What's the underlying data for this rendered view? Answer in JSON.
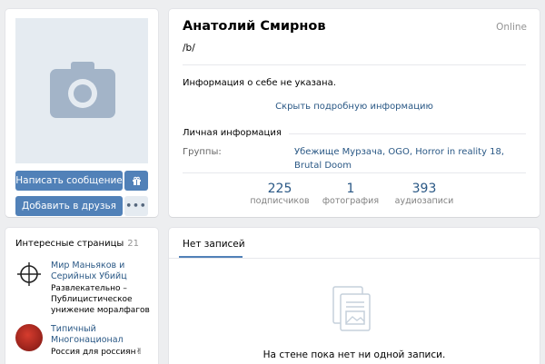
{
  "profile": {
    "name": "Анатолий Смирнов",
    "online": "Online",
    "status": "/b/",
    "about": "Информация о себе не указана.",
    "toggle_details": "Скрыть подробную информацию",
    "section_title": "Личная информация",
    "groups_label": "Группы:",
    "groups_value": "Убежище Мурзача, OGO, Horror in reality 18, Brutal Doom",
    "counters": [
      {
        "value": "225",
        "label": "подписчиков"
      },
      {
        "value": "1",
        "label": "фотография"
      },
      {
        "value": "393",
        "label": "аудиозаписи"
      }
    ]
  },
  "actions": {
    "message_label": "Написать сообщение",
    "add_friend_label": "Добавить в друзья",
    "gift_icon": "gift-icon",
    "more_icon": "more-icon"
  },
  "pages": {
    "title": "Интересные страницы",
    "count": "21",
    "items": [
      {
        "name": "Мир Маньяков и Серийных Убийц",
        "desc": "Развлекательно – Публицистическое унижение моралфагов",
        "icon": "crosshair-icon"
      },
      {
        "name": "Типичный Многонационал",
        "desc": "Россия для россиян✌",
        "icon": "community-avatar"
      }
    ]
  },
  "wall": {
    "tab": "Нет записей",
    "empty_text": "На стене пока нет ни одной записи.",
    "empty_icon": "document-icon"
  },
  "colors": {
    "accent": "#5181b8",
    "link": "#2a5885",
    "background": "#edeef0"
  }
}
